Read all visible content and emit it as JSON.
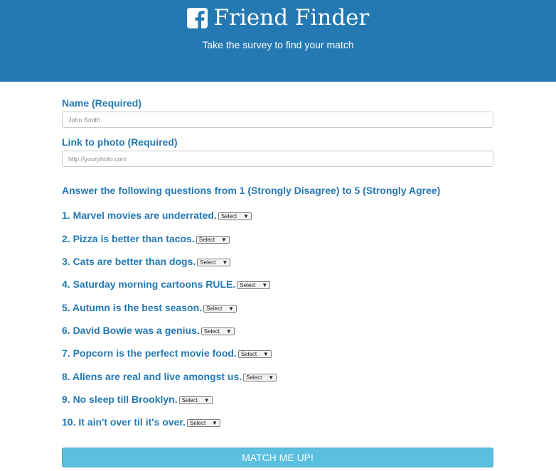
{
  "header": {
    "brand_title": "Friend Finder",
    "subtitle": "Take the survey to find your match",
    "logo_icon": "facebook-icon",
    "background_color": "#2479b3"
  },
  "form": {
    "name_label": "Name (Required)",
    "name_placeholder": "John Smith",
    "photo_label": "Link to photo (Required)",
    "photo_placeholder": "http://yourphoto.com",
    "instructions": "Answer the following questions from 1 (Strongly Disagree) to 5 (Strongly Agree)",
    "questions": [
      {
        "text": "1. Marvel movies are underrated.",
        "select": "Select"
      },
      {
        "text": "2. Pizza is better than tacos.",
        "select": "Select"
      },
      {
        "text": "3. Cats are better than dogs.",
        "select": "Select"
      },
      {
        "text": "4. Saturday morning cartoons RULE.",
        "select": "Select"
      },
      {
        "text": "5. Autumn is the best season.",
        "select": "Select"
      },
      {
        "text": "6. David Bowie was a genius.",
        "select": "Select"
      },
      {
        "text": "7. Popcorn is the perfect movie food.",
        "select": "Select"
      },
      {
        "text": "8. Aliens are real and live amongst us.",
        "select": "Select"
      },
      {
        "text": "9. No sleep till Brooklyn.",
        "select": "Select"
      },
      {
        "text": "10. It ain't over til it's over.",
        "select": "Select"
      }
    ],
    "submit_label": "MATCH ME UP!",
    "accent_color": "#2479b3",
    "button_color": "#5bbfde"
  }
}
